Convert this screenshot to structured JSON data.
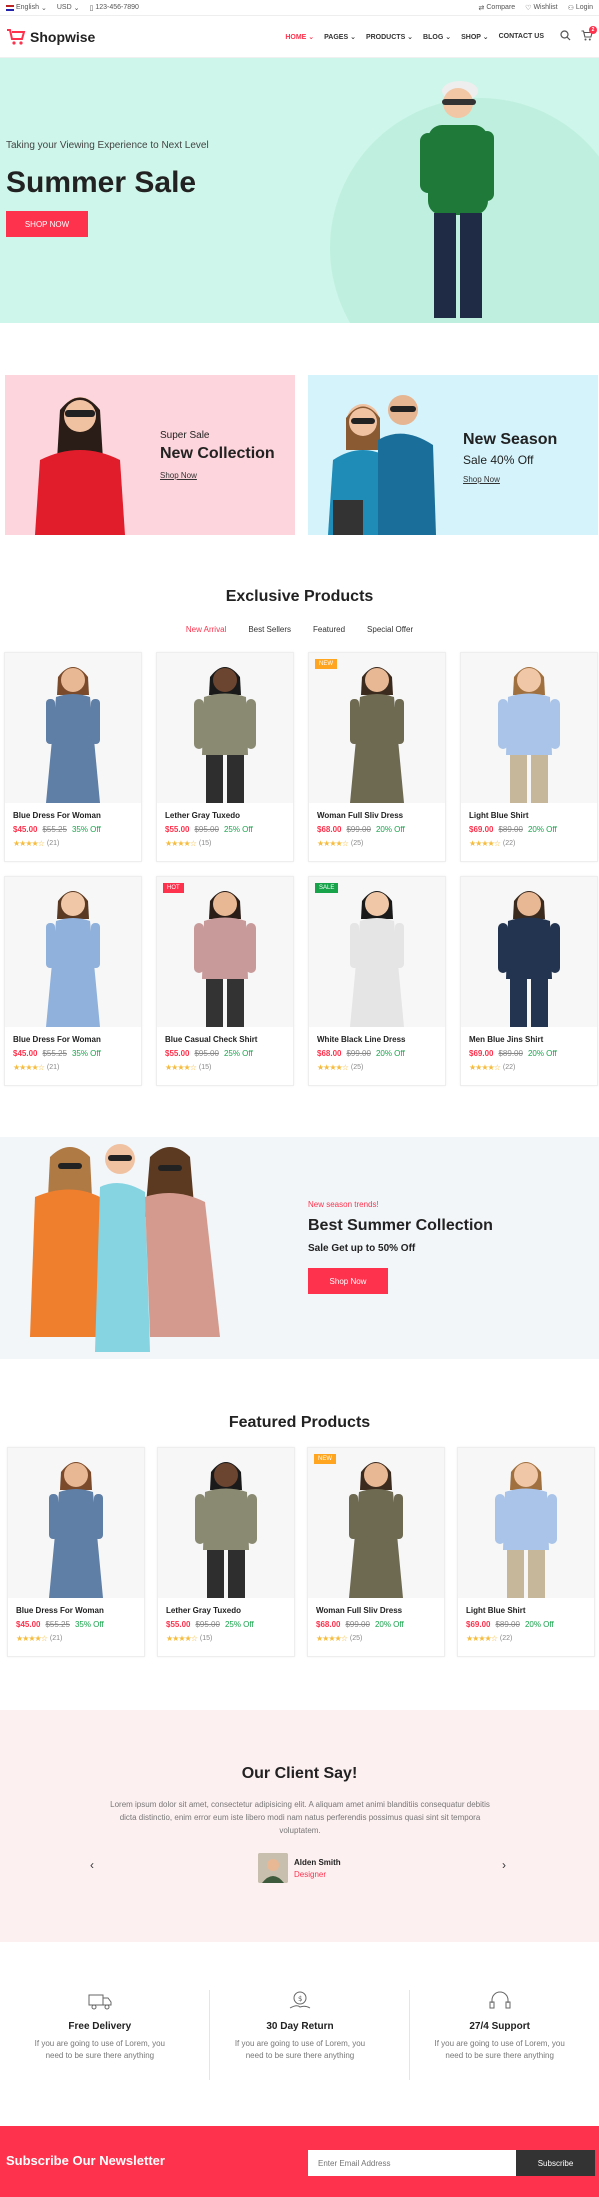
{
  "topbar": {
    "language": "English",
    "currency": "USD",
    "phone": "123-456-7890",
    "compare": "Compare",
    "wishlist": "Wishlist",
    "login": "Login"
  },
  "header": {
    "logo": "Shopwise",
    "nav": [
      "HOME",
      "PAGES",
      "PRODUCTS",
      "BLOG",
      "SHOP",
      "CONTACT US"
    ],
    "cart_count": "2"
  },
  "hero": {
    "tagline": "Taking your Viewing Experience to Next Level",
    "title": "Summer Sale",
    "button": "SHOP NOW"
  },
  "banners": [
    {
      "small": "Super Sale",
      "big": "New Collection",
      "link": "Shop Now"
    },
    {
      "big": "New Season",
      "sub": "Sale 40% Off",
      "link": "Shop Now"
    }
  ],
  "exclusive": {
    "title": "Exclusive Products",
    "tabs": [
      "New Arrival",
      "Best Sellers",
      "Featured",
      "Special Offer"
    ],
    "products": [
      {
        "name": "Blue Dress For Woman",
        "price": "$45.00",
        "old": "$55.25",
        "off": "35% Off",
        "reviews": "(21)"
      },
      {
        "name": "Lether Gray Tuxedo",
        "price": "$55.00",
        "old": "$95.00",
        "off": "25% Off",
        "reviews": "(15)"
      },
      {
        "name": "Woman Full Sliv Dress",
        "price": "$68.00",
        "old": "$99.00",
        "off": "20% Off",
        "reviews": "(25)",
        "badge": "NEW"
      },
      {
        "name": "Light Blue Shirt",
        "price": "$69.00",
        "old": "$89.00",
        "off": "20% Off",
        "reviews": "(22)"
      },
      {
        "name": "Blue Dress For Woman",
        "price": "$45.00",
        "old": "$55.25",
        "off": "35% Off",
        "reviews": "(21)"
      },
      {
        "name": "Blue Casual Check Shirt",
        "price": "$55.00",
        "old": "$95.00",
        "off": "25% Off",
        "reviews": "(15)",
        "badge": "HOT"
      },
      {
        "name": "White Black Line Dress",
        "price": "$68.00",
        "old": "$99.00",
        "off": "20% Off",
        "reviews": "(25)",
        "badge": "SALE"
      },
      {
        "name": "Men Blue Jins Shirt",
        "price": "$69.00",
        "old": "$89.00",
        "off": "20% Off",
        "reviews": "(22)"
      }
    ]
  },
  "summer": {
    "kicker": "New season trends!",
    "title": "Best Summer Collection",
    "subtitle": "Sale Get up to 50% Off",
    "button": "Shop Now"
  },
  "featured": {
    "title": "Featured Products",
    "products": [
      {
        "name": "Blue Dress For Woman",
        "price": "$45.00",
        "old": "$55.25",
        "off": "35% Off",
        "reviews": "(21)"
      },
      {
        "name": "Lether Gray Tuxedo",
        "price": "$55.00",
        "old": "$95.00",
        "off": "25% Off",
        "reviews": "(15)"
      },
      {
        "name": "Woman Full Sliv Dress",
        "price": "$68.00",
        "old": "$99.00",
        "off": "20% Off",
        "reviews": "(25)",
        "badge": "NEW"
      },
      {
        "name": "Light Blue Shirt",
        "price": "$69.00",
        "old": "$89.00",
        "off": "20% Off",
        "reviews": "(22)"
      }
    ]
  },
  "testimonial": {
    "title": "Our Client Say!",
    "text": "Lorem ipsum dolor sit amet, consectetur adipisicing elit. A aliquam amet animi blanditiis consequatur debitis dicta distinctio, enim error eum iste libero modi nam natus perferendis possimus quasi sint sit tempora voluptatem.",
    "name": "Alden Smith",
    "role": "Designer"
  },
  "features": [
    {
      "title": "Free Delivery",
      "desc": "If you are going to use of Lorem, you need to be sure there anything"
    },
    {
      "title": "30 Day Return",
      "desc": "If you are going to use of Lorem, you need to be sure there anything"
    },
    {
      "title": "27/4 Support",
      "desc": "If you are going to use of Lorem, you need to be sure there anything"
    }
  ],
  "newsletter": {
    "title": "Subscribe Our Newsletter",
    "placeholder": "Enter Email Address",
    "button": "Subscribe"
  },
  "colors": {
    "accent": "#ff324d",
    "hero_bg": "#cef6ea",
    "pink_banner": "#fdd5dc",
    "blue_banner": "#d5f3fb",
    "new_badge": "#ffa51f",
    "hot_badge": "#ff324d",
    "sale_badge": "#16a34a"
  }
}
